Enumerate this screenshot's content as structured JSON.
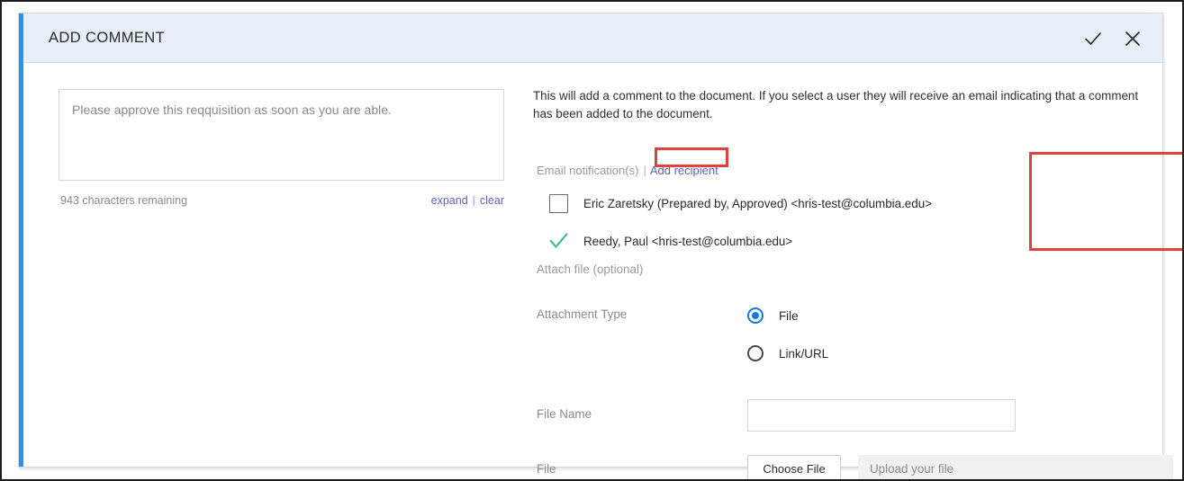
{
  "panel": {
    "title": "ADD COMMENT",
    "accent_color": "#2196f3",
    "header_bg": "#e7f0f9",
    "confirm_icon": "check-icon",
    "close_icon": "close-icon"
  },
  "comment": {
    "value": "Please approve this reqquisition as soon as you are able.",
    "placeholder": "",
    "char_count": "943 characters remaining",
    "expand_label": "expand",
    "separator": "|",
    "clear_label": "clear"
  },
  "description": "This will add a comment to the document. If you select a user they will receive an email indicating that a comment has been added to the document.",
  "email": {
    "heading": "Email notification(s)",
    "separator": "|",
    "add_recipient_label": "Add recipient",
    "recipients": [
      {
        "label": "Eric Zaretsky (Prepared by, Approved) <hris-test@columbia.edu>",
        "selected": false
      },
      {
        "label": "Reedy, Paul <hris-test@columbia.edu>",
        "selected": true
      }
    ]
  },
  "attachment": {
    "section_label": "Attach file (optional)",
    "type_label": "Attachment Type",
    "options": [
      {
        "label": "File",
        "selected": true
      },
      {
        "label": "Link/URL",
        "selected": false
      }
    ],
    "file_name_label": "File Name",
    "file_name_value": "",
    "file_label": "File",
    "choose_file_label": "Choose File",
    "upload_placeholder": "Upload your file"
  },
  "annotation": {
    "color": "#e0413b"
  }
}
